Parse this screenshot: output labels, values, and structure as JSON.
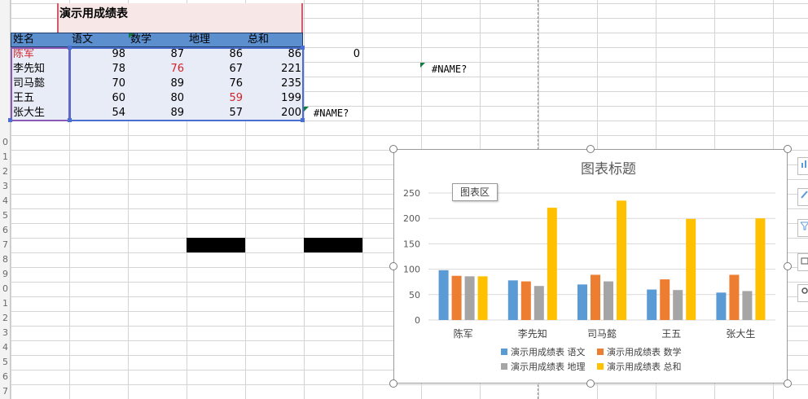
{
  "sheet": {
    "title": "演示用成绩表",
    "headers": [
      "姓名",
      "语文",
      "数学",
      "地理",
      "总和"
    ],
    "rows": [
      {
        "name": "陈军",
        "yuwen": "98",
        "shuxue": "87",
        "dili": "86",
        "zonghe": "86"
      },
      {
        "name": "李先知",
        "yuwen": "78",
        "shuxue": "76",
        "dili": "67",
        "zonghe": "221"
      },
      {
        "name": "司马懿",
        "yuwen": "70",
        "shuxue": "89",
        "dili": "76",
        "zonghe": "235"
      },
      {
        "name": "王五",
        "yuwen": "60",
        "shuxue": "80",
        "dili": "59",
        "zonghe": "199"
      },
      {
        "name": "张大生",
        "yuwen": "54",
        "shuxue": "89",
        "dili": "57",
        "zonghe": "200"
      }
    ],
    "cell_zero": "0",
    "name_error_1": "#NAME?",
    "name_error_2": "#NAME?",
    "row_numbers": [
      "0",
      "1",
      "2",
      "3",
      "4",
      "5",
      "6",
      "7",
      "8",
      "9",
      "0",
      "1",
      "2",
      "3",
      "4",
      "5",
      "6",
      "7"
    ]
  },
  "chart_tooltip": "图表区",
  "colors": {
    "series1": "#5b9bd5",
    "series2": "#ed7d31",
    "series3": "#a5a5a5",
    "series4": "#ffc000"
  },
  "chart_data": {
    "type": "bar",
    "title": "图表标题",
    "categories": [
      "陈军",
      "李先知",
      "司马懿",
      "王五",
      "张大生"
    ],
    "series": [
      {
        "name": "演示用成绩表 语文",
        "values": [
          98,
          78,
          70,
          60,
          54
        ]
      },
      {
        "name": "演示用成绩表 数学",
        "values": [
          87,
          76,
          89,
          80,
          89
        ]
      },
      {
        "name": "演示用成绩表 地理",
        "values": [
          86,
          67,
          76,
          59,
          57
        ]
      },
      {
        "name": "演示用成绩表 总和",
        "values": [
          86,
          221,
          235,
          199,
          200
        ]
      }
    ],
    "ylim": [
      0,
      250
    ],
    "yticks": [
      "0",
      "50",
      "100",
      "150",
      "200",
      "250"
    ],
    "grid": true,
    "legend": "bottom"
  }
}
